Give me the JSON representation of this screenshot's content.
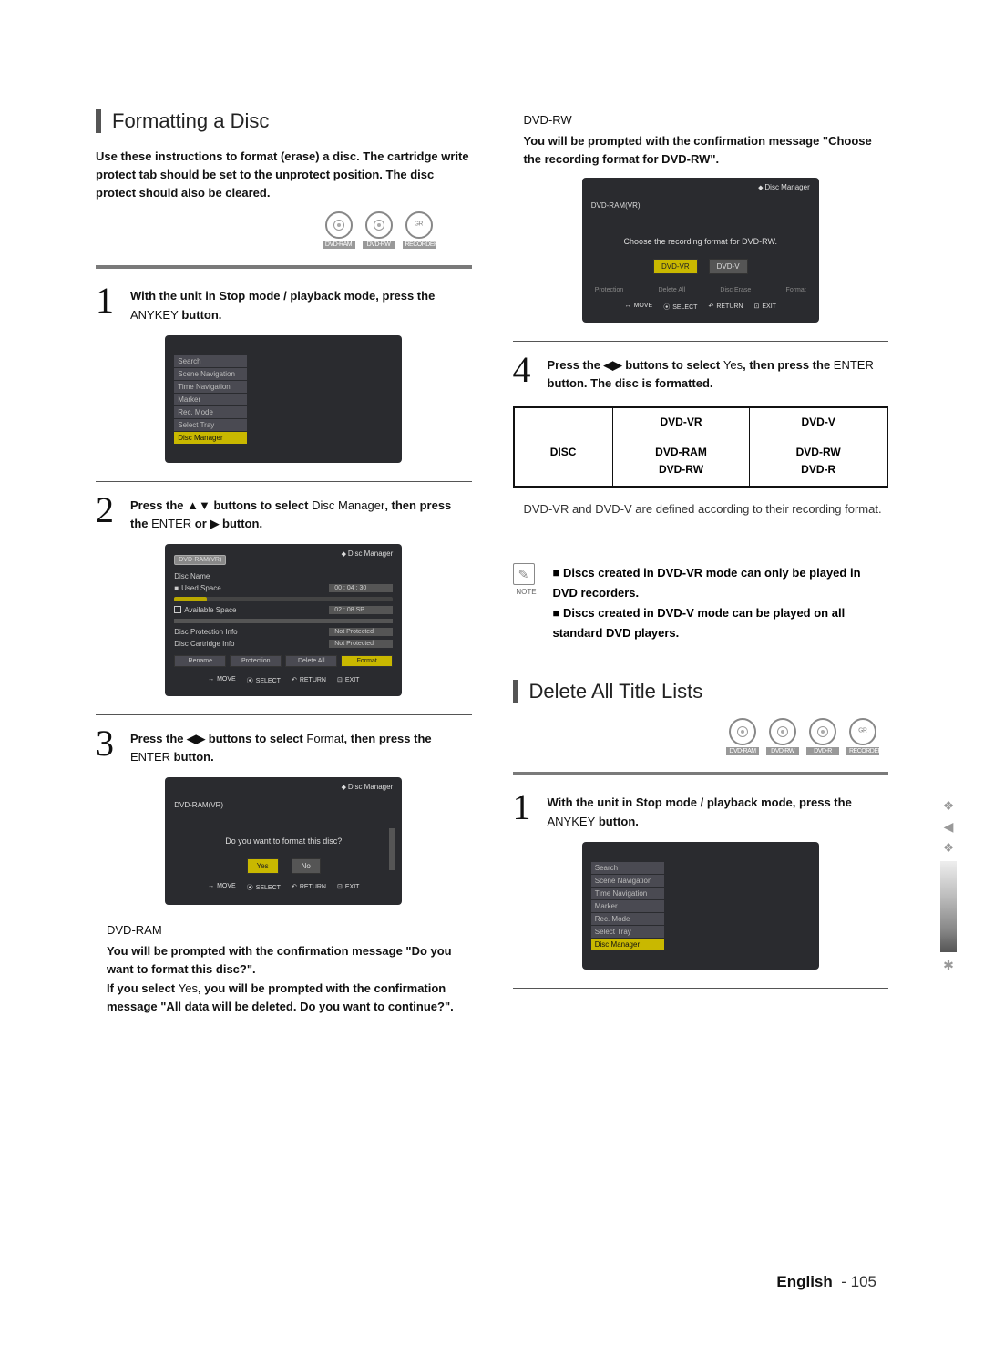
{
  "section_formatting": {
    "title": "Formatting a Disc",
    "intro": "Use these instructions to format (erase) a disc. The cartridge write protect tab should be set to the unprotect position. The disc protect should also be cleared.",
    "icons": [
      "DVD-RAM",
      "DVD-RW",
      "RECORDER"
    ]
  },
  "step1": {
    "text_a": "With the unit in Stop mode / playback mode, press the ",
    "anykey": "ANYKEY",
    "text_b": " button."
  },
  "menu_panel": {
    "items": [
      "Search",
      "Scene Navigation",
      "Time Navigation",
      "Marker",
      "Rec. Mode",
      "Select Tray",
      "Disc Manager"
    ],
    "active_index": 6
  },
  "step2": {
    "text_a": "Press the ▲▼ buttons to select ",
    "highlight1": "Disc Manager",
    "text_b": ", then press the ",
    "enter": "ENTER",
    "text_c": " or ▶ button."
  },
  "disc_mgr_panel": {
    "hdr": "Disc Manager",
    "badge": "DVD-RAM(VR)",
    "rows": {
      "name": "Disc Name",
      "used": "Used Space",
      "used_val": "00 : 04 : 30",
      "avail": "Available Space",
      "avail_val": "02 : 08 SP",
      "prot": "Disc Protection Info",
      "prot_val": "Not Protected",
      "cart": "Disc Cartridge Info",
      "cart_val": "Not Protected"
    },
    "buttons": [
      "Rename",
      "Protection",
      "Delete All",
      "Format"
    ],
    "active_btn": 3,
    "nav": {
      "move": "MOVE",
      "select": "SELECT",
      "return": "RETURN",
      "exit": "EXIT"
    }
  },
  "step3": {
    "text_a": "Press the ◀▶ buttons to select ",
    "highlight1": "Format",
    "text_b": ", then press the ",
    "enter": "ENTER",
    "text_c": " button."
  },
  "format_prompt_panel": {
    "hdr": "Disc Manager",
    "badge": "DVD-RAM(VR)",
    "prompt": "Do you want to format this disc?",
    "yes": "Yes",
    "no": "No"
  },
  "dvd_ram_block": {
    "heading": "DVD-RAM",
    "p1": "You will be prompted with the confirmation message \"Do you want to format this disc?\".",
    "p2": "If you select ",
    "yes": "Yes",
    "p2b": ", you will be prompted with the confirmation message \"All data will be deleted. Do you want to continue?\"."
  },
  "dvd_rw_block": {
    "heading": "DVD-RW",
    "p1": "You will be prompted with the confirmation message \"Choose the recording format for DVD-RW\"."
  },
  "format_choice_panel": {
    "hdr": "Disc Manager",
    "badge": "DVD-RAM(VR)",
    "prompt": "Choose the recording format for DVD-RW.",
    "opt1": "DVD-VR",
    "opt2": "DVD-V"
  },
  "step4": {
    "text_a": "Press the ◀▶ buttons to select ",
    "yes": "Yes",
    "text_b": ", then press the ",
    "enter": "ENTER",
    "text_c": " button. The disc is formatted."
  },
  "table": {
    "h1": "DVD-VR",
    "h2": "DVD-V",
    "lbl": "DISC",
    "c1a": "DVD-RAM",
    "c1b": "DVD-RW",
    "c2a": "DVD-RW",
    "c2b": "DVD-R"
  },
  "table_caption": "DVD-VR and DVD-V are defined according to their recording format.",
  "note": {
    "label": "NOTE",
    "line1": "Discs created in DVD-VR mode can only be played in DVD recorders.",
    "line2": "Discs created in DVD-V mode can be played on all standard DVD players."
  },
  "section_delete": {
    "title": "Delete All Title Lists",
    "icons": [
      "DVD-RAM",
      "DVD-RW",
      "DVD-R",
      "RECORDER"
    ]
  },
  "step1_delete": {
    "text_a": "With the unit in Stop mode / playback mode, press the ",
    "anykey": "ANYKEY",
    "text_b": " button."
  },
  "footer": {
    "lang": "English",
    "sep": "-",
    "page": "105"
  }
}
